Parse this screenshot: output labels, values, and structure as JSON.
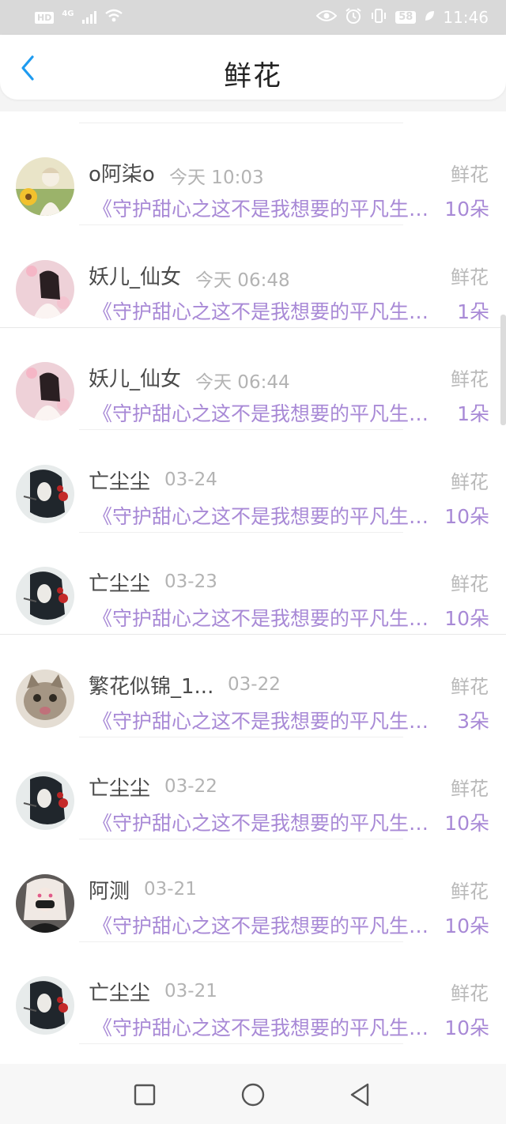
{
  "status_bar": {
    "left_tags": [
      "HD",
      "4G"
    ],
    "battery": "58",
    "time": "11:46"
  },
  "header": {
    "title": "鲜花"
  },
  "colors": {
    "accent": "#1e9bf0",
    "purple": "#a889d6",
    "muted": "#b3b3b3"
  },
  "items": [
    {
      "name": "o阿柒o",
      "time": "今天 10:03",
      "gift_type": "鲜花",
      "book": "《守护甜心之这不是我想要的平凡生活》",
      "count": "10朵",
      "avatar": "sunflower-girl"
    },
    {
      "name": "妖儿_仙女",
      "time": "今天 06:48",
      "gift_type": "鲜花",
      "book": "《守护甜心之这不是我想要的平凡生活》",
      "count": "1朵",
      "avatar": "pink-girl"
    },
    {
      "name": "妖儿_仙女",
      "time": "今天 06:44",
      "gift_type": "鲜花",
      "book": "《守护甜心之这不是我想要的平凡生活》",
      "count": "1朵",
      "avatar": "pink-girl"
    },
    {
      "name": "亡尘尘",
      "time": "03-24",
      "gift_type": "鲜花",
      "book": "《守护甜心之这不是我想要的平凡生活》",
      "count": "10朵",
      "avatar": "dark-hair-girl"
    },
    {
      "name": "亡尘尘",
      "time": "03-23",
      "gift_type": "鲜花",
      "book": "《守护甜心之这不是我想要的平凡生活》",
      "count": "10朵",
      "avatar": "dark-hair-girl"
    },
    {
      "name": "繁花似锦_1...",
      "time": "03-22",
      "gift_type": "鲜花",
      "book": "《守护甜心之这不是我想要的平凡生活》",
      "count": "3朵",
      "avatar": "cat"
    },
    {
      "name": "亡尘尘",
      "time": "03-22",
      "gift_type": "鲜花",
      "book": "《守护甜心之这不是我想要的平凡生活》",
      "count": "10朵",
      "avatar": "dark-hair-girl"
    },
    {
      "name": "阿测",
      "time": "03-21",
      "gift_type": "鲜花",
      "book": "《守护甜心之这不是我想要的平凡生活》",
      "count": "10朵",
      "avatar": "masked-girl"
    },
    {
      "name": "亡尘尘",
      "time": "03-21",
      "gift_type": "鲜花",
      "book": "《守护甜心之这不是我想要的平凡生活》",
      "count": "10朵",
      "avatar": "dark-hair-girl"
    }
  ],
  "nav": {
    "buttons": [
      "recents",
      "home",
      "back"
    ]
  }
}
